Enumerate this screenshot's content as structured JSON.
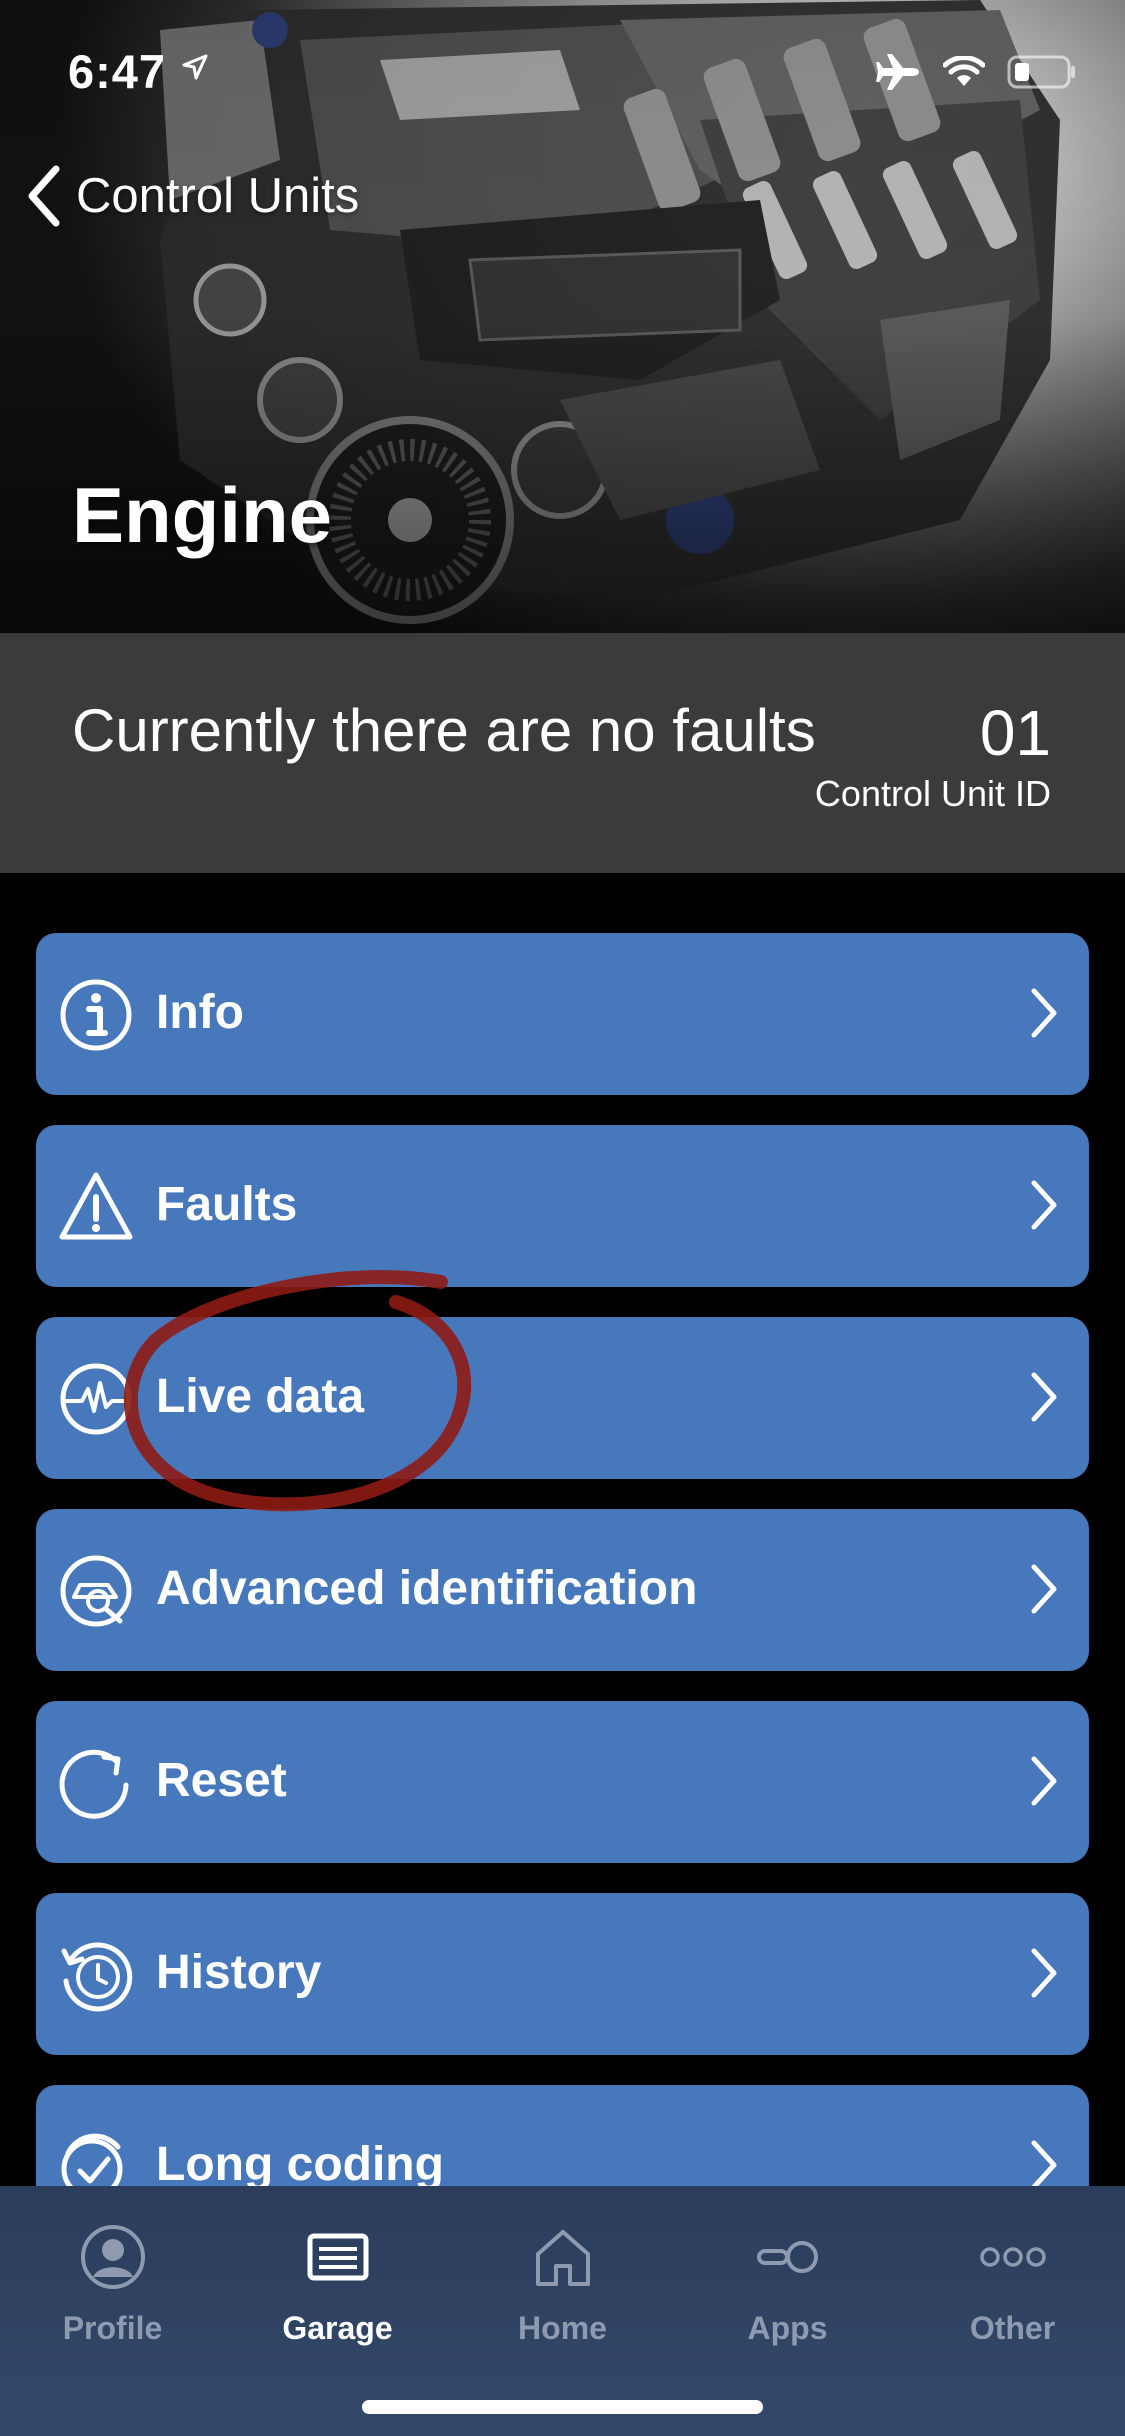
{
  "status_bar": {
    "time": "6:47"
  },
  "nav": {
    "back_label": "Control Units"
  },
  "header": {
    "title": "Engine"
  },
  "summary": {
    "faults_status": "Currently there are no faults",
    "unit_id": "01",
    "unit_id_label": "Control Unit ID"
  },
  "menu": {
    "items": [
      {
        "label": "Info",
        "icon": "info-icon"
      },
      {
        "label": "Faults",
        "icon": "warning-icon"
      },
      {
        "label": "Live data",
        "icon": "live-data-icon"
      },
      {
        "label": "Advanced identification",
        "icon": "advanced-identification-icon"
      },
      {
        "label": "Reset",
        "icon": "reset-icon"
      },
      {
        "label": "History",
        "icon": "history-icon"
      },
      {
        "label": "Long coding",
        "icon": "long-coding-icon"
      }
    ],
    "highlighted_item": "Live data"
  },
  "tabbar": {
    "tabs": [
      {
        "label": "Profile",
        "icon": "profile-icon",
        "active": false
      },
      {
        "label": "Garage",
        "icon": "garage-icon",
        "active": true
      },
      {
        "label": "Home",
        "icon": "home-icon",
        "active": false
      },
      {
        "label": "Apps",
        "icon": "apps-icon",
        "active": false
      },
      {
        "label": "Other",
        "icon": "other-icon",
        "active": false
      }
    ]
  },
  "colors": {
    "menu_item_bg": "#4878bc",
    "summary_bg": "#3b3b3b",
    "tabbar_bg": "#2f4264",
    "tab_active": "#ffffff",
    "tab_inactive": "#8e9ab0",
    "annotation": "#8e1b14"
  }
}
